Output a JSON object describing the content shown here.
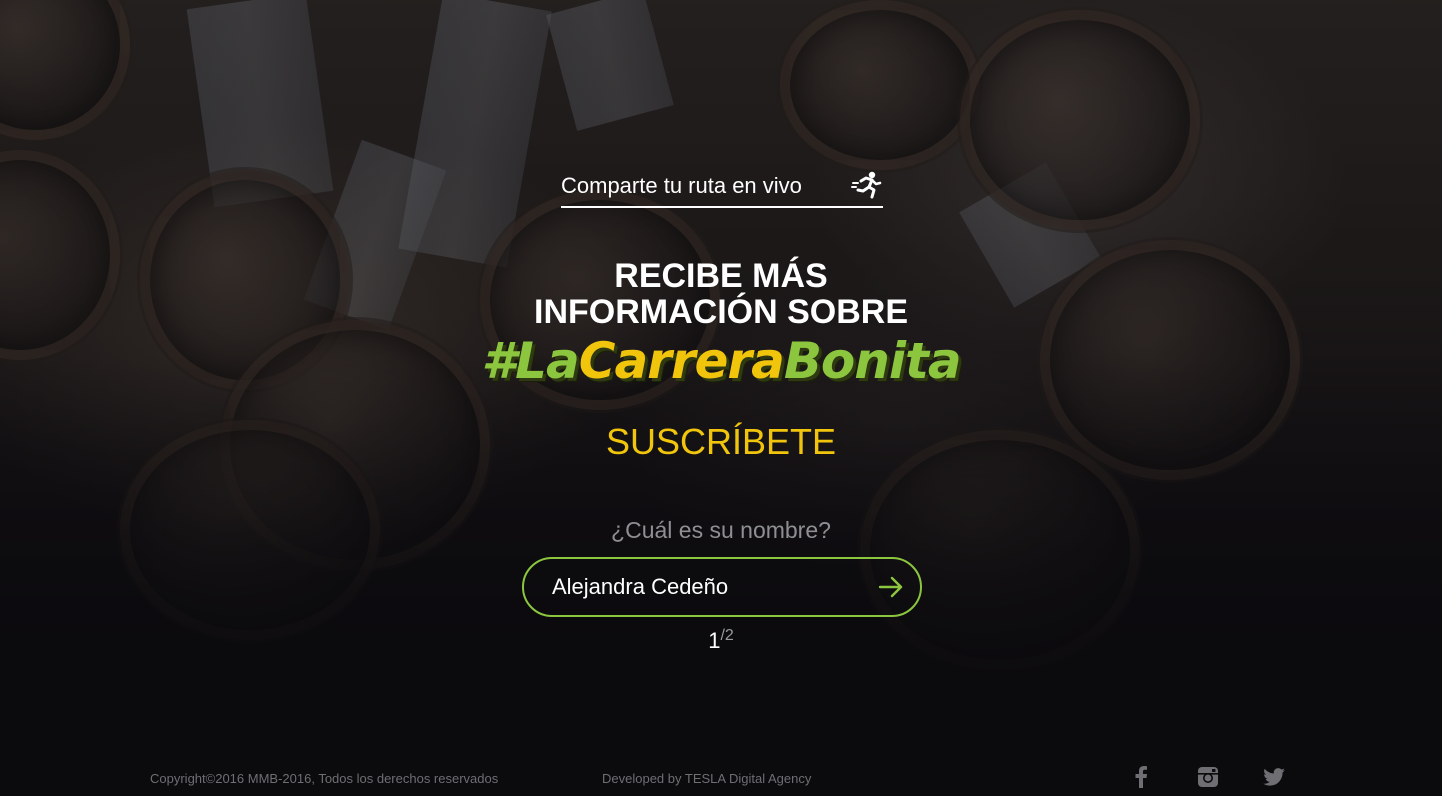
{
  "share": {
    "label": "Comparte tu ruta en vivo",
    "icon": "runner-icon"
  },
  "hero": {
    "headline_line1": "RECIBE MÁS",
    "headline_line2": "INFORMACIÓN SOBRE",
    "hashtag_hash": "#",
    "hashtag_word1": "La",
    "hashtag_word2": "Carrera",
    "hashtag_word3": "Bonita"
  },
  "form": {
    "title": "SUSCRÍBETE",
    "question": "¿Cuál es su nombre?",
    "name_value": "Alejandra Cedeño",
    "submit_icon": "arrow-right-icon",
    "step_current": "1",
    "step_total": "/2"
  },
  "footer": {
    "copyright": "Copyright©2016 MMB-2016, Todos los derechos reservados",
    "developer": "Developed by TESLA Digital Agency",
    "social": [
      "facebook-icon",
      "instagram-icon",
      "twitter-icon"
    ]
  },
  "colors": {
    "accent_green": "#8cc63f",
    "accent_yellow": "#f2c50d",
    "background": "#0b0a0d"
  }
}
